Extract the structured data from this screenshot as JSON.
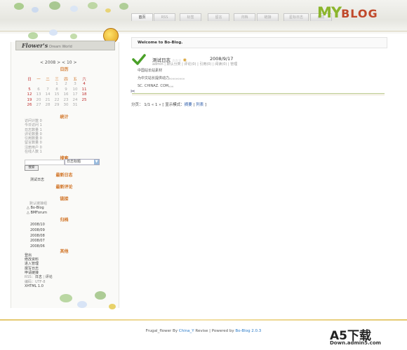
{
  "nav": {
    "tabs": [
      "首页",
      "RSS",
      "标签",
      "留言",
      "归档",
      "链接",
      "星标日志",
      "成员"
    ]
  },
  "logo": {
    "my": "MY",
    "blog": "BLOG"
  },
  "sidebar": {
    "title": "Flower's",
    "subtitle": "Dream World",
    "calendar": {
      "nav": "< 2008 >  < 10 >",
      "heading": "日历",
      "weekdays": [
        "日",
        "一",
        "二",
        "三",
        "四",
        "五",
        "六"
      ],
      "rows": [
        [
          "",
          "",
          "",
          "1",
          "2",
          "3",
          "4"
        ],
        [
          "5",
          "6",
          "7",
          "8",
          "9",
          "10",
          "11"
        ],
        [
          "12",
          "13",
          "14",
          "15",
          "16",
          "17",
          "18"
        ],
        [
          "19",
          "20",
          "21",
          "22",
          "23",
          "24",
          "25"
        ],
        [
          "26",
          "27",
          "28",
          "29",
          "30",
          "31",
          ""
        ]
      ]
    },
    "stats": {
      "heading": "统计",
      "items": [
        "访问计数 0",
        "今日访问 1",
        "日志数量 1",
        "评论数量 0",
        "引用数量 0",
        "留言数量 0",
        "注册用户 0",
        "在线人数 1"
      ]
    },
    "search": {
      "heading": "搜索",
      "select_value": "日志标题",
      "button": "搜索"
    },
    "latest_posts": {
      "heading": "最新日志",
      "items": [
        "测试日志"
      ]
    },
    "latest_comments": {
      "heading": "最新评论"
    },
    "links": {
      "heading": "链接",
      "group": "默认链接组",
      "items": [
        "Bo-Blog",
        "BMForum"
      ]
    },
    "archive": {
      "heading": "归档",
      "items": [
        "2008/10",
        "2008/09",
        "2008/08",
        "2008/07",
        "2008/06"
      ]
    },
    "other": {
      "heading": "其他",
      "items": [
        "登出",
        "修改资料",
        "进入管理",
        "撰写日志",
        "申请链接"
      ],
      "rss": "RSS：",
      "rss_post": "日志",
      "rss_sep": " | ",
      "rss_comment": "评论",
      "encoding": "编码：UTF-8",
      "xhtml": "XHTML 1.0"
    }
  },
  "main": {
    "welcome": "Welcome to Bo-Blog.",
    "entry": {
      "title": "测试日志",
      "stars": "☆☆☆",
      "date": "2008/9/17",
      "meta": "admin | 默认分类 | 评论(0) | 引用(0) | 阅读(0) | 管理",
      "lines": [
        "中国站长站素材",
        "为中文站长提供动力。。。。。。。。。",
        "SC. CHINAZ. COM。。。"
      ]
    },
    "pager": {
      "prefix": "分页：",
      "pages": "1/1",
      "first": "«",
      "current": "1",
      "last": "»",
      "mode_open": " [ 显示模式：",
      "mode_summary": "摘要",
      "mode_sep": " | ",
      "mode_list": "列表",
      "mode_close": " ]"
    }
  },
  "footer": {
    "prefix": "Frugal_flower By ",
    "author": "China_Y",
    "mid": " Revise | Powered by ",
    "engine": "Bo-Blog 2.0.3"
  },
  "watermark": {
    "big": "A5下载",
    "small": "Down.admin5.com"
  },
  "colors": {
    "accent_orange": "#d07020",
    "link_blue": "#2a5aa8",
    "weekend_red": "#c03030",
    "logo_green": "#8bb52c",
    "logo_red": "#c0482a"
  }
}
